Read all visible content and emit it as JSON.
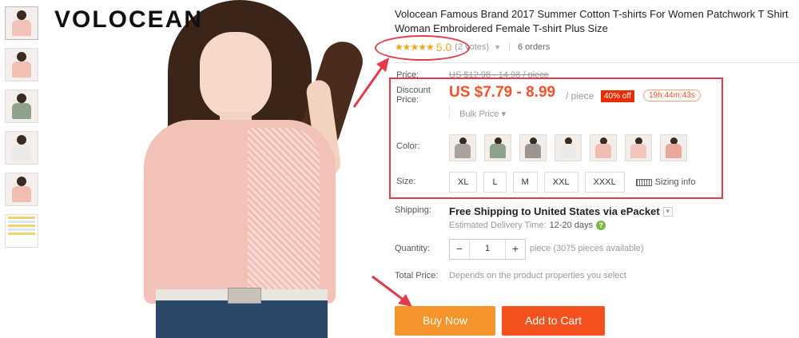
{
  "brand": {
    "logo_text": "VOLOCEAN"
  },
  "product": {
    "title": "Volocean Famous Brand 2017 Summer Cotton T-shirts For Women Patchwork T Shirt Woman Embroidered Female T-shirt Plus Size",
    "rating": {
      "stars": "★★★★★",
      "value": "5.0",
      "votes": "(2 votes)",
      "orders": "6 orders"
    }
  },
  "price": {
    "label": "Price:",
    "original": "US $12.98 - 14.98 / piece",
    "discount_label": "Discount Price:",
    "discount": "US $7.79 - 8.99",
    "unit": "/ piece",
    "off_badge": "40% off",
    "timer": "19h:44m:43s",
    "bulk": "Bulk Price ▾"
  },
  "color": {
    "label": "Color:",
    "swatch_colors": [
      "#a9a3a0",
      "#8ea18b",
      "#9a9591",
      "#eceae8",
      "#f0bdb3",
      "#f2c6bc",
      "#e8a89a"
    ]
  },
  "size": {
    "label": "Size:",
    "options": [
      "XL",
      "L",
      "M",
      "XXL",
      "XXXL"
    ],
    "sizing_info": "Sizing info"
  },
  "shipping": {
    "label": "Shipping:",
    "text": "Free Shipping to United States via ePacket",
    "delivery_label": "Estimated Delivery Time:",
    "delivery_days": "12-20 days"
  },
  "quantity": {
    "label": "Quantity:",
    "minus": "−",
    "value": "1",
    "plus": "+",
    "available": "piece (3075 pieces available)"
  },
  "total": {
    "label": "Total Price:",
    "text": "Depends on the product properties you select"
  },
  "buttons": {
    "buy_now": "Buy Now",
    "add_to_cart": "Add to Cart"
  },
  "thumbnail_colors": [
    "#f2c2b8",
    "#f0c0b5",
    "#8ea18b",
    "#eceae8",
    "#f0bdb3"
  ],
  "colors": {
    "accent_red": "#e23b4a",
    "price_orange": "#f3522a",
    "buy_now": "#f4942a",
    "add_to_cart": "#f4511e"
  }
}
